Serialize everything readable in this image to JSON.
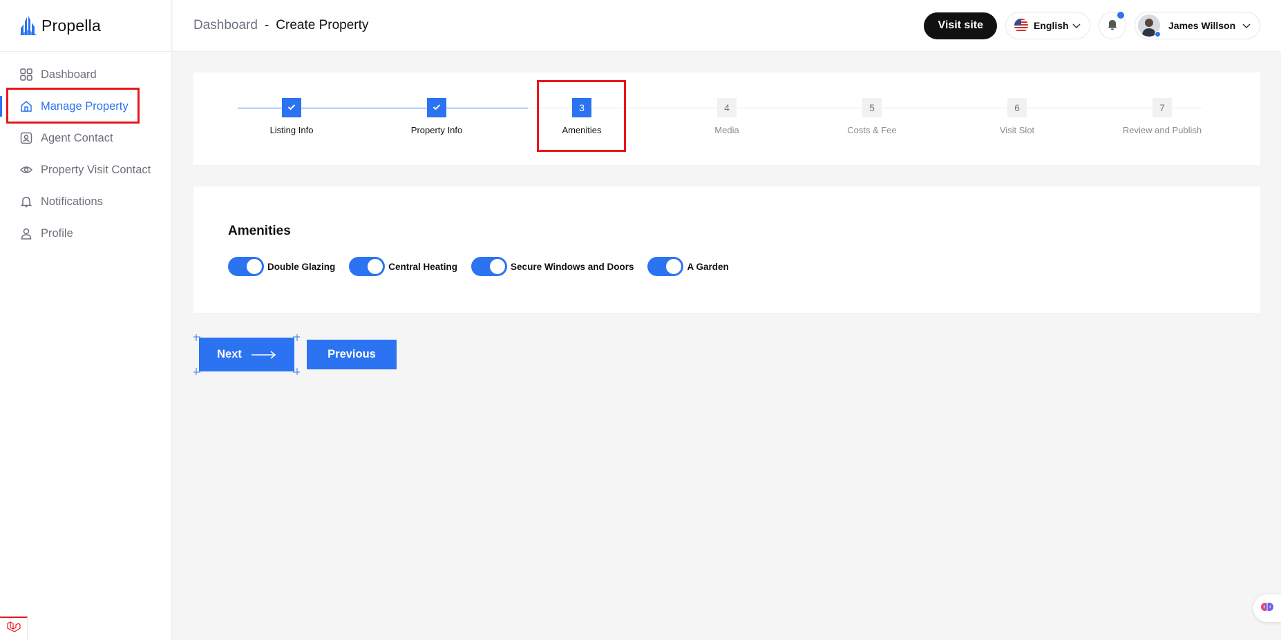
{
  "brand": {
    "name": "Propella",
    "logo_icon": "building-logo-icon"
  },
  "sidebar": {
    "items": [
      {
        "label": "Dashboard",
        "icon": "grid-icon",
        "active": false
      },
      {
        "label": "Manage Property",
        "icon": "home-icon",
        "active": true
      },
      {
        "label": "Agent Contact",
        "icon": "contact-card-icon",
        "active": false
      },
      {
        "label": "Property Visit Contact",
        "icon": "eye-icon",
        "active": false
      },
      {
        "label": "Notifications",
        "icon": "bell-icon",
        "active": false
      },
      {
        "label": "Profile",
        "icon": "user-icon",
        "active": false
      }
    ]
  },
  "header": {
    "breadcrumb_root": "Dashboard",
    "breadcrumb_sep": "-",
    "breadcrumb_current": "Create Property",
    "visit_site_label": "Visit site",
    "language": "English",
    "user_name": "James Willson"
  },
  "stepper": {
    "steps": [
      {
        "number": "1",
        "label": "Listing Info",
        "state": "done"
      },
      {
        "number": "2",
        "label": "Property Info",
        "state": "done"
      },
      {
        "number": "3",
        "label": "Amenities",
        "state": "current"
      },
      {
        "number": "4",
        "label": "Media",
        "state": "todo"
      },
      {
        "number": "5",
        "label": "Costs & Fee",
        "state": "todo"
      },
      {
        "number": "6",
        "label": "Visit Slot",
        "state": "todo"
      },
      {
        "number": "7",
        "label": "Review and Publish",
        "state": "todo"
      }
    ]
  },
  "amenities": {
    "title": "Amenities",
    "options": [
      {
        "label": "Double Glazing",
        "on": true
      },
      {
        "label": "Central Heating",
        "on": true
      },
      {
        "label": "Secure Windows and Doors",
        "on": true
      },
      {
        "label": "A Garden",
        "on": true
      }
    ]
  },
  "actions": {
    "next_label": "Next",
    "previous_label": "Previous"
  },
  "colors": {
    "accent": "#2b73f0",
    "highlight": "#e8151b",
    "dark": "#111111"
  }
}
